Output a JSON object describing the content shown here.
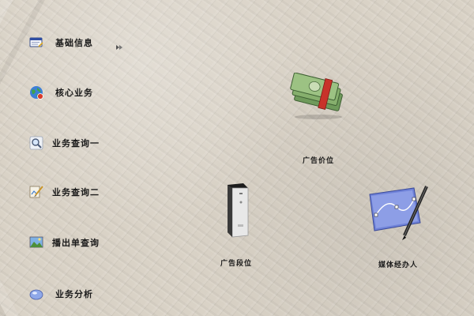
{
  "menu": {
    "items": [
      {
        "label": "基础信息",
        "icon": "notepad-icon"
      },
      {
        "label": "核心业务",
        "icon": "globe-icon"
      },
      {
        "label": "业务查询一",
        "icon": "magnifier-icon"
      },
      {
        "label": "业务查询二",
        "icon": "paint-brush-icon"
      },
      {
        "label": "播出单查询",
        "icon": "landscape-photo-icon"
      },
      {
        "label": "业务分析",
        "icon": "disc-icon"
      }
    ]
  },
  "desktop": {
    "icons": [
      {
        "label": "广告价位",
        "icon": "money-stack-icon"
      },
      {
        "label": "广告段位",
        "icon": "server-tower-icon"
      },
      {
        "label": "媒体经办人",
        "icon": "vector-pen-icon"
      }
    ]
  },
  "colors": {
    "background": "#d9d2c6",
    "text": "#1a1a1a"
  }
}
